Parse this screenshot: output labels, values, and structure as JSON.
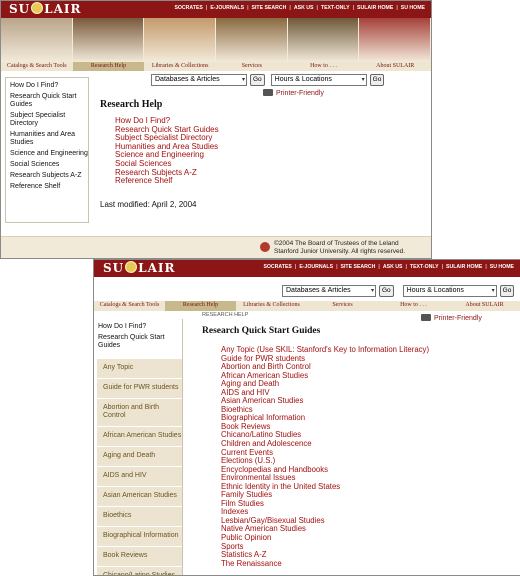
{
  "brand": {
    "left": "SU",
    "right": "LAIR"
  },
  "toplinks": [
    "SOCRATES",
    "E-JOURNALS",
    "SITE SEARCH",
    "ASK US",
    "TEXT-ONLY",
    "SULAIR HOME",
    "SU HOME"
  ],
  "nav": [
    "Catalogs & Search Tools",
    "Research Help",
    "Libraries & Collections",
    "Services",
    "How to . . .",
    "About SULAIR"
  ],
  "selects": {
    "databases": "Databases & Articles",
    "hours": "Hours & Locations",
    "go": "Go"
  },
  "printer": "Printer-Friendly",
  "banner_colors": [
    "#b9a58a",
    "#7a5a3c",
    "#c49a6c",
    "#8a6a40",
    "#6e5a3a",
    "#a5413a"
  ],
  "page1": {
    "sidebar": [
      "How Do I Find?",
      "Research Quick Start Guides",
      "Subject Specialist Directory",
      "Humanities and Area Studies",
      "Science and Engineering",
      "Social Sciences",
      "Research Subjects A-Z",
      "Reference Shelf"
    ],
    "title": "Research Help",
    "links": [
      "How Do I Find?",
      "Research Quick Start Guides",
      "Subject Specialist Directory",
      "Humanities and Area Studies",
      "Science and Engineering",
      "Social Sciences",
      "Research Subjects A-Z",
      "Reference Shelf"
    ],
    "modified": "Last modified: April 2, 2004",
    "copyright_line1": "©2004 The Board of Trustees of the Leland",
    "copyright_line2": "Stanford Junior University. All rights reserved."
  },
  "page2": {
    "breadcrumb": "RESEARCH HELP",
    "sidebar_top": [
      "How Do I Find?",
      "Research Quick Start Guides"
    ],
    "sidebar_sub": [
      "Any Topic",
      "Guide for PWR students",
      "Abortion and Birth Control",
      "African American Studies",
      "Aging and Death",
      "AIDS and HIV",
      "Asian American Studies",
      "Bioethics",
      "Biographical Information",
      "Book Reviews",
      "Chicano/Latino Studies"
    ],
    "title": "Research Quick Start Guides",
    "links": [
      "Any Topic (Use SKIL: Stanford's Key to Information Literacy)",
      "Guide for PWR students",
      "Abortion and Birth Control",
      "African American Studies",
      "Aging and Death",
      "AIDS and HIV",
      "Asian American Studies",
      "Bioethics",
      "Biographical Information",
      "Book Reviews",
      "Chicano/Latino Studies",
      "Children and Adolescence",
      "Current Events",
      "Elections (U.S.)",
      "Encyclopedias and Handbooks",
      "Environmental Issues",
      "Ethnic Identity in the United States",
      "Family Studies",
      "Film Studies",
      "Indexes",
      "Lesbian/Gay/Bisexual Studies",
      "Native American Studies",
      "Public Opinion",
      "Sports",
      "Statistics A-Z",
      "The Renaissance"
    ]
  }
}
